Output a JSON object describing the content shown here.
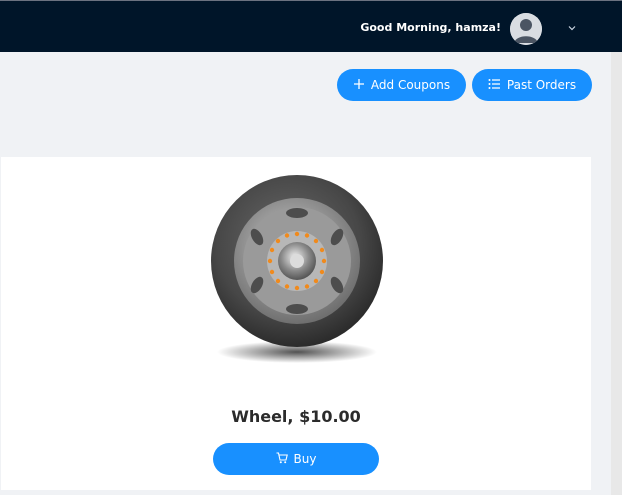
{
  "header": {
    "greeting": "Good Morning, hamza!",
    "avatar_icon": "user-avatar-icon",
    "menu_icon": "chevron-down-icon"
  },
  "actions": {
    "add_coupons": {
      "label": "Add Coupons",
      "icon": "plus-icon"
    },
    "past_orders": {
      "label": "Past Orders",
      "icon": "list-icon"
    }
  },
  "product": {
    "image_icon": "wheel-image",
    "name": "Wheel, $10.00",
    "buy_label": "Buy",
    "buy_icon": "cart-icon"
  },
  "colors": {
    "header_bg": "#001529",
    "primary": "#1890ff",
    "page_bg": "#f0f2f5"
  }
}
